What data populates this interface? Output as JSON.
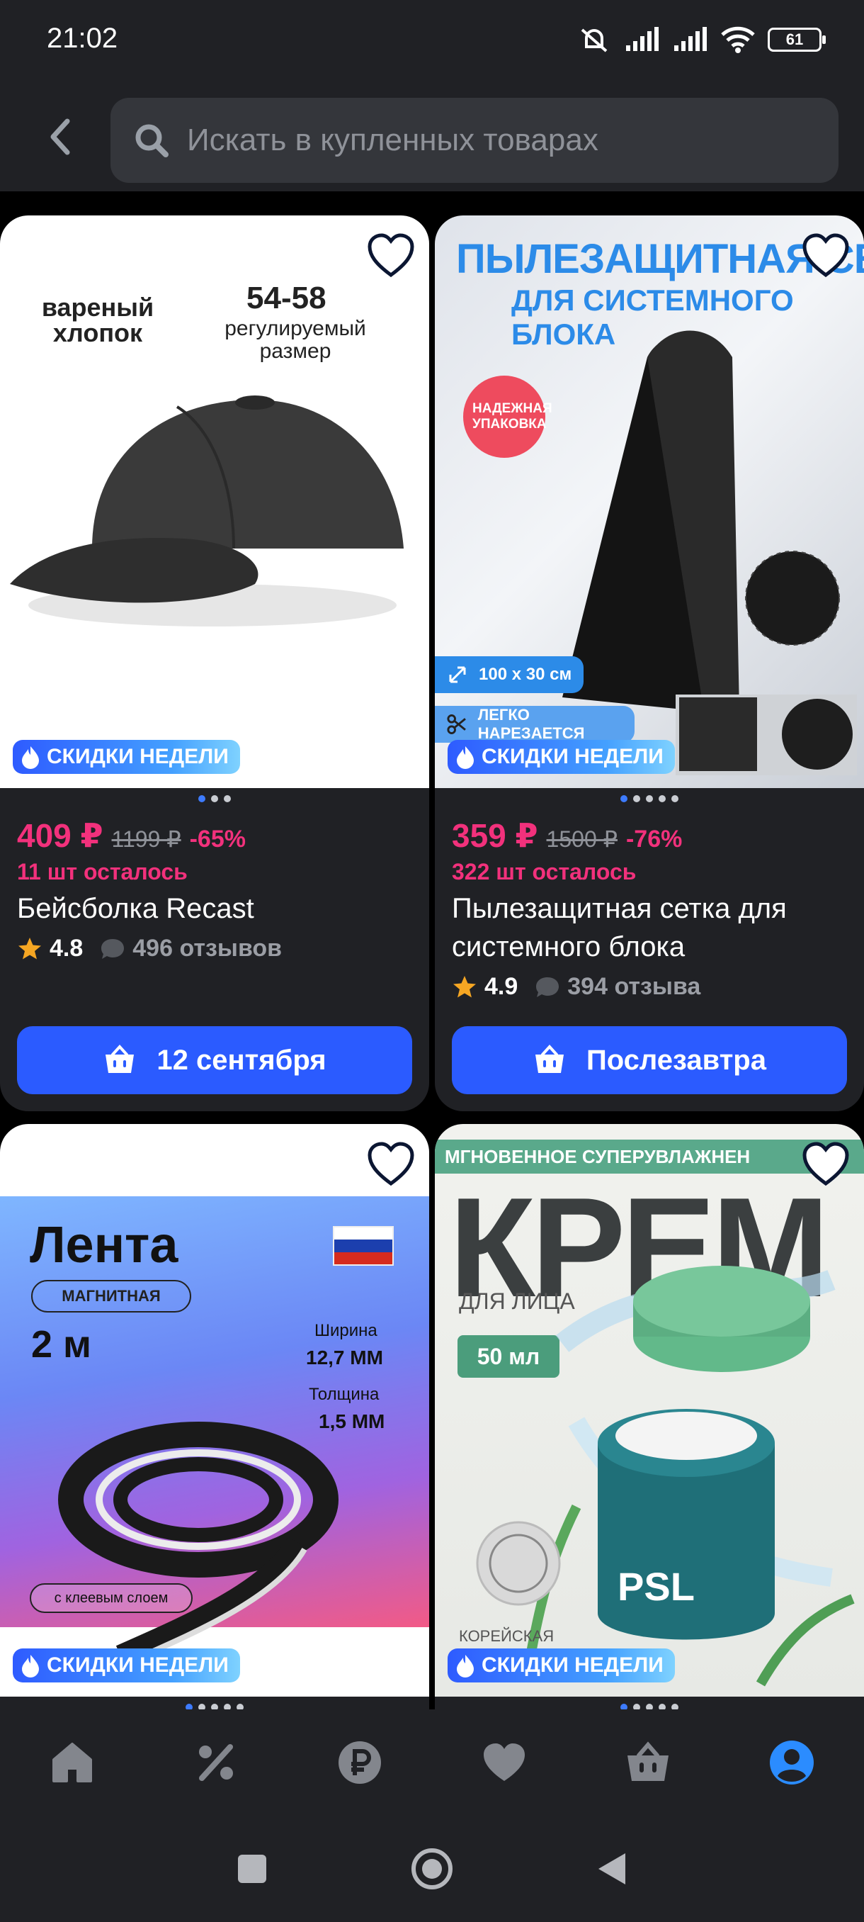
{
  "status_bar": {
    "time": "21:02",
    "battery": "61"
  },
  "search": {
    "placeholder": "Искать в купленных товарах"
  },
  "promo_label": "СКИДКИ НЕДЕЛИ",
  "products": [
    {
      "price": "409 ₽",
      "old_price": "1199 ₽",
      "discount": "-65%",
      "stock": "11 шт осталось",
      "title": "Бейсболка Recast",
      "rating": "4.8",
      "reviews": "496 отзывов",
      "delivery": "12 сентября",
      "image_text": {
        "left": "вареный хлопок",
        "size": "54-58",
        "size_note": "регулируемый размер"
      }
    },
    {
      "price": "359 ₽",
      "old_price": "1500 ₽",
      "discount": "-76%",
      "stock": "322 шт осталось",
      "title": "Пылезащитная сетка для системного блока",
      "rating": "4.9",
      "reviews": "394 отзыва",
      "delivery": "Послезавтра",
      "image_text": {
        "headline": "ПЫЛЕЗАЩИТНАЯ СЕТКА",
        "sub": "ДЛЯ СИСТЕМНОГО БЛОКА",
        "badge": "НАДЕЖНАЯ УПАКОВКА",
        "dims": "100 х 30 см",
        "cut": "ЛЕГКО НАРЕЗАЕТСЯ"
      }
    },
    {
      "image_text": {
        "title": "Лента",
        "tag": "МАГНИТНАЯ",
        "length": "2 м",
        "width_label": "Ширина",
        "width_value": "12,7 ММ",
        "thick_label": "Толщина",
        "thick_value": "1,5 ММ",
        "note": "с клеевым слоем"
      }
    },
    {
      "image_text": {
        "top": "МГНОВЕННОЕ СУПЕРУВЛАЖНЕН",
        "title": "КРЕМ",
        "sub": "ДЛЯ ЛИЦА",
        "volume": "50 мл",
        "brand": "PSL",
        "origin": "КОРЕЙСКАЯ"
      }
    }
  ]
}
